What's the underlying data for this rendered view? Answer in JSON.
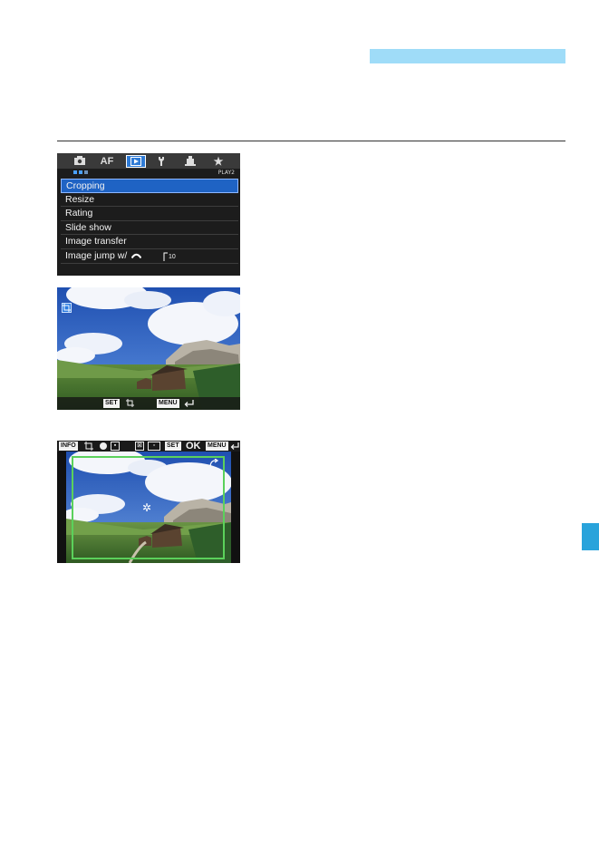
{
  "page": {
    "header_bar_color": "#9fdcf8",
    "side_tab_color": "#29a3db"
  },
  "menu_screen": {
    "tabs": [
      {
        "name": "camera",
        "label": ""
      },
      {
        "name": "af",
        "label": "AF"
      },
      {
        "name": "playback",
        "label": ""
      },
      {
        "name": "setup",
        "label": ""
      },
      {
        "name": "custom",
        "label": ""
      },
      {
        "name": "my-menu",
        "label": "★"
      }
    ],
    "active_tab": "playback",
    "page_label": "PLAY2",
    "items": [
      {
        "label": "Cropping",
        "selected": true
      },
      {
        "label": "Resize"
      },
      {
        "label": "Rating"
      },
      {
        "label": "Slide show"
      },
      {
        "label": "Image transfer"
      },
      {
        "label": "Image jump w/",
        "value": "10"
      }
    ]
  },
  "photo_screen": {
    "set_key": "SET",
    "menu_key": "MENU",
    "crop_icon": "crop-icon",
    "return_icon": "return-icon"
  },
  "crop_screen": {
    "info_key": "INFO",
    "set_key": "SET",
    "ok_label": "OK",
    "menu_key": "MENU",
    "frame_color": "#5bd15b"
  }
}
